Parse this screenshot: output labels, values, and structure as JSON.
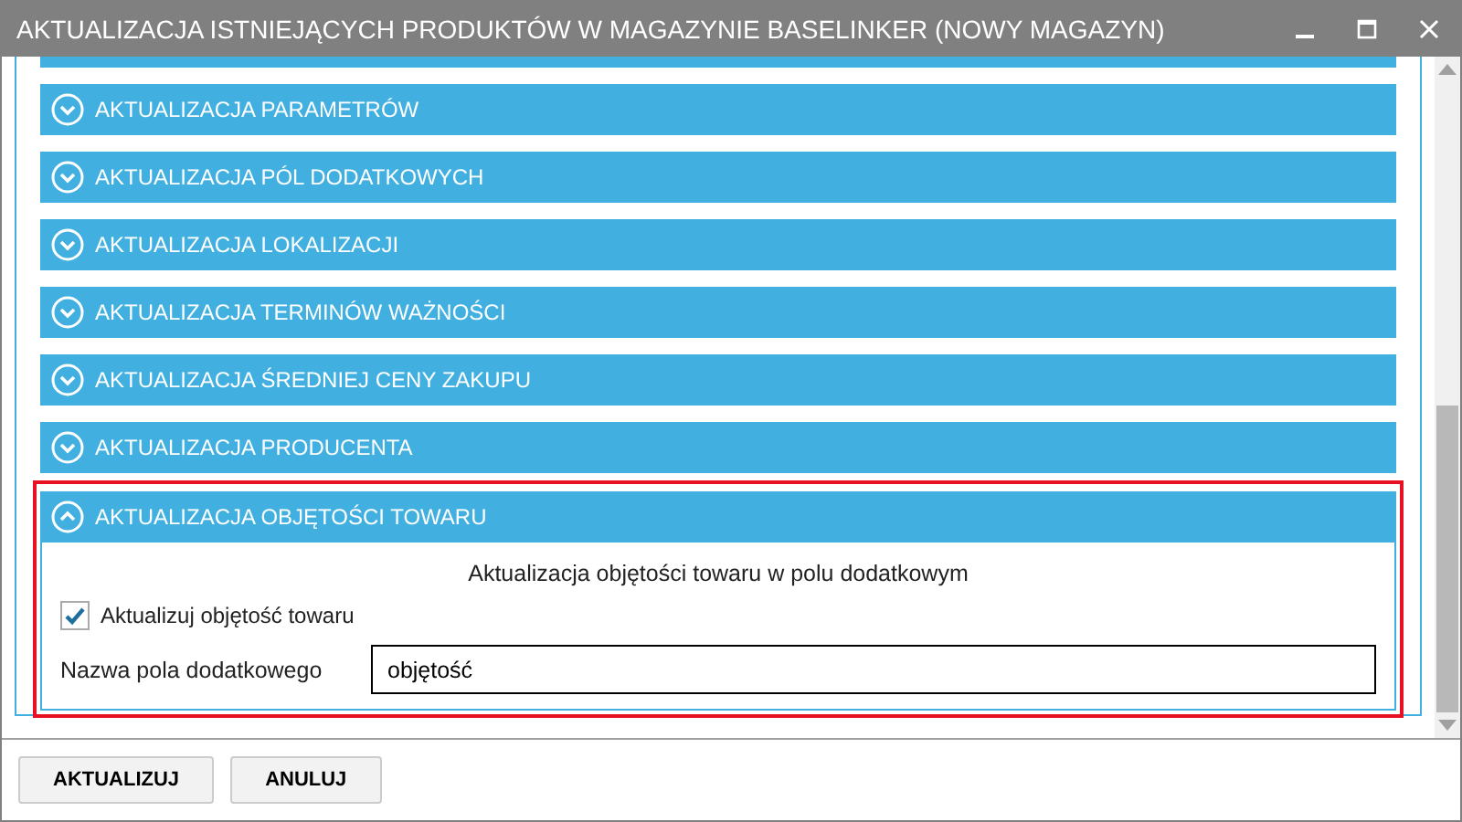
{
  "window": {
    "title": "AKTUALIZACJA ISTNIEJĄCYCH PRODUKTÓW W MAGAZYNIE BASELINKER (NOWY MAGAZYN)"
  },
  "sections": [
    {
      "title": "AKTUALIZACJA PARAMETRÓW",
      "expanded": false
    },
    {
      "title": "AKTUALIZACJA PÓL DODATKOWYCH",
      "expanded": false
    },
    {
      "title": "AKTUALIZACJA LOKALIZACJI",
      "expanded": false
    },
    {
      "title": "AKTUALIZACJA TERMINÓW WAŻNOŚCI",
      "expanded": false
    },
    {
      "title": "AKTUALIZACJA ŚREDNIEJ CENY ZAKUPU",
      "expanded": false
    },
    {
      "title": "AKTUALIZACJA PRODUCENTA",
      "expanded": false
    },
    {
      "title": "AKTUALIZACJA OBJĘTOŚCI TOWARU",
      "expanded": true,
      "caption": "Aktualizacja objętości towaru w polu dodatkowym",
      "checkbox": {
        "label": "Aktualizuj objętość towaru",
        "checked": true
      },
      "field": {
        "label": "Nazwa pola dodatkowego",
        "value": "objętość"
      }
    }
  ],
  "buttons": [
    "AKTUALIZUJ",
    "ANULUJ"
  ]
}
